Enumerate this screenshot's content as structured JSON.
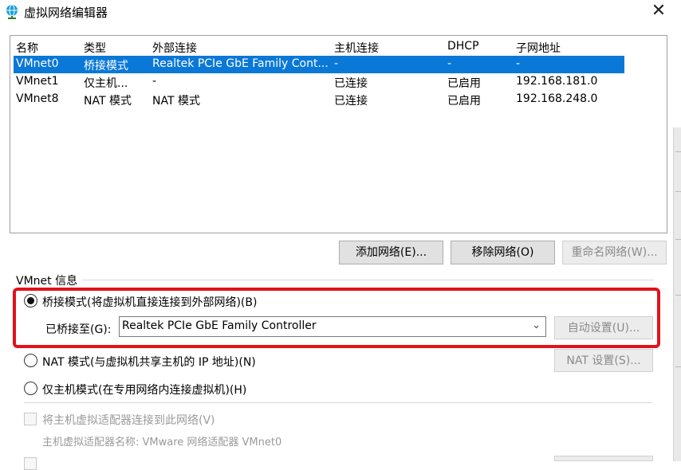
{
  "window": {
    "title": "虚拟网络编辑器",
    "close_glyph": "✕"
  },
  "table": {
    "headers": [
      "名称",
      "类型",
      "外部连接",
      "主机连接",
      "DHCP",
      "子网地址"
    ],
    "rows": [
      {
        "name": "VMnet0",
        "type": "桥接模式",
        "external": "Realtek PCIe GbE Family Cont...",
        "host": "-",
        "dhcp": "-",
        "subnet": "-",
        "selected": true
      },
      {
        "name": "VMnet1",
        "type": "仅主机...",
        "external": "-",
        "host": "已连接",
        "dhcp": "已启用",
        "subnet": "192.168.181.0",
        "selected": false
      },
      {
        "name": "VMnet8",
        "type": "NAT 模式",
        "external": "NAT 模式",
        "host": "已连接",
        "dhcp": "已启用",
        "subnet": "192.168.248.0",
        "selected": false
      }
    ]
  },
  "buttons": {
    "add_network": "添加网络(E)...",
    "remove_network": "移除网络(O)",
    "rename_network": "重命名网络(W)...",
    "auto_settings": "自动设置(U)...",
    "nat_settings": "NAT 设置(S)..."
  },
  "vmnet_info": {
    "group_label": "VMnet 信息",
    "bridged_label": "桥接模式(将虚拟机直接连接到外部网络)(B)",
    "bridged_to_label": "已桥接至(G):",
    "bridged_to_value": "Realtek PCIe GbE Family Controller",
    "nat_label": "NAT 模式(与虚拟机共享主机的 IP 地址)(N)",
    "hostonly_label": "仅主机模式(在专用网络内连接虚拟机)(H)",
    "selected_mode": "bridged",
    "connect_adapter_label": "将主机虚拟适配器连接到此网络(V)",
    "adapter_name_label": "主机虚拟适配器名称: VMware 网络适配器 VMnet0"
  },
  "colors": {
    "selection": "#0a78d7",
    "highlight_border": "#e0121b",
    "title_icon": "#1a9fd8"
  },
  "icons": {
    "title": "globe-network-icon",
    "combo_arrow": "chevron-down-icon"
  }
}
